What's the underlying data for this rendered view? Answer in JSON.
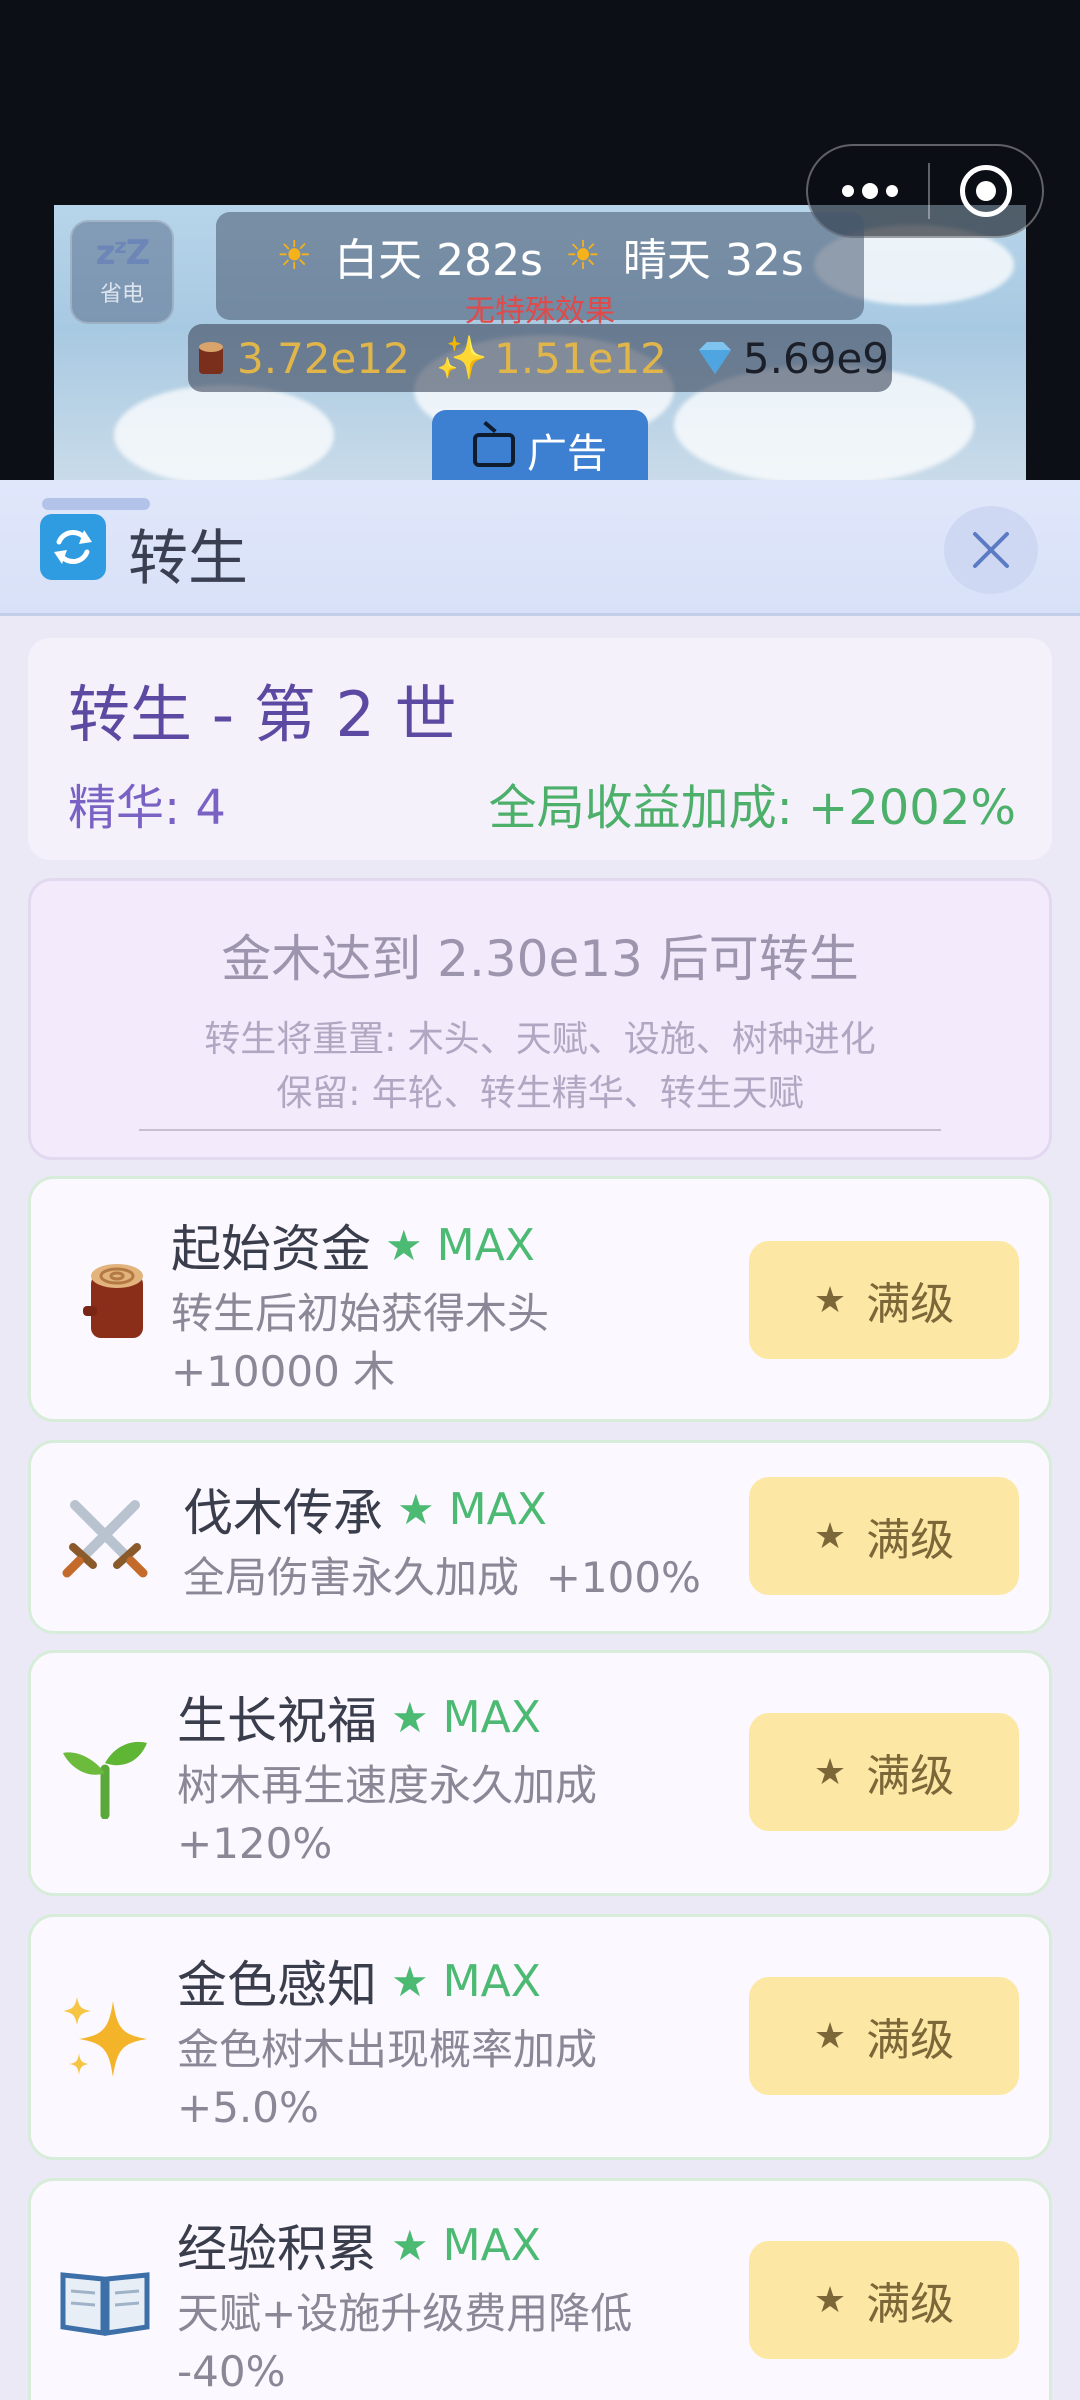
{
  "status_bar": {
    "capsule_menu_icon": "more-dots-icon",
    "capsule_close_icon": "target-icon"
  },
  "game": {
    "sleep_label": "省电",
    "day_label": "白天 282s",
    "weather_label": "晴天 32s",
    "effect_label": "无特殊效果",
    "wood": "3.72e12",
    "gold_wood": "1.51e12",
    "diamond": "5.69e9",
    "ad_label": "广告"
  },
  "panel": {
    "title": "转生",
    "info": {
      "title": "转生 - 第 2 世",
      "essence": "精华: 4",
      "bonus": "全局收益加成: +2002%"
    },
    "condition": {
      "main": "金木达到 2.30e13 后可转生",
      "reset": "转生将重置: 木头、天赋、设施、树种进化",
      "keep": "保留: 年轮、转生精华、转生天赋"
    },
    "skills": [
      {
        "name": "起始资金",
        "max": "MAX",
        "desc1": "转生后初始获得木头",
        "desc2": "+10000 木",
        "button": "满级",
        "icon": "log-icon"
      },
      {
        "name": "伐木传承",
        "max": "MAX",
        "desc1": "全局伤害永久加成  +100%",
        "desc2": "",
        "button": "满级",
        "icon": "crossed-swords-icon"
      },
      {
        "name": "生长祝福",
        "max": "MAX",
        "desc1": "树木再生速度永久加成",
        "desc2": "+120%",
        "button": "满级",
        "icon": "sprout-icon"
      },
      {
        "name": "金色感知",
        "max": "MAX",
        "desc1": "金色树木出现概率加成",
        "desc2": "+5.0%",
        "button": "满级",
        "icon": "sparkles-icon"
      },
      {
        "name": "经验积累",
        "max": "MAX",
        "desc1": "天赋+设施升级费用降低",
        "desc2": "-40%",
        "button": "满级",
        "icon": "open-book-icon"
      }
    ]
  }
}
